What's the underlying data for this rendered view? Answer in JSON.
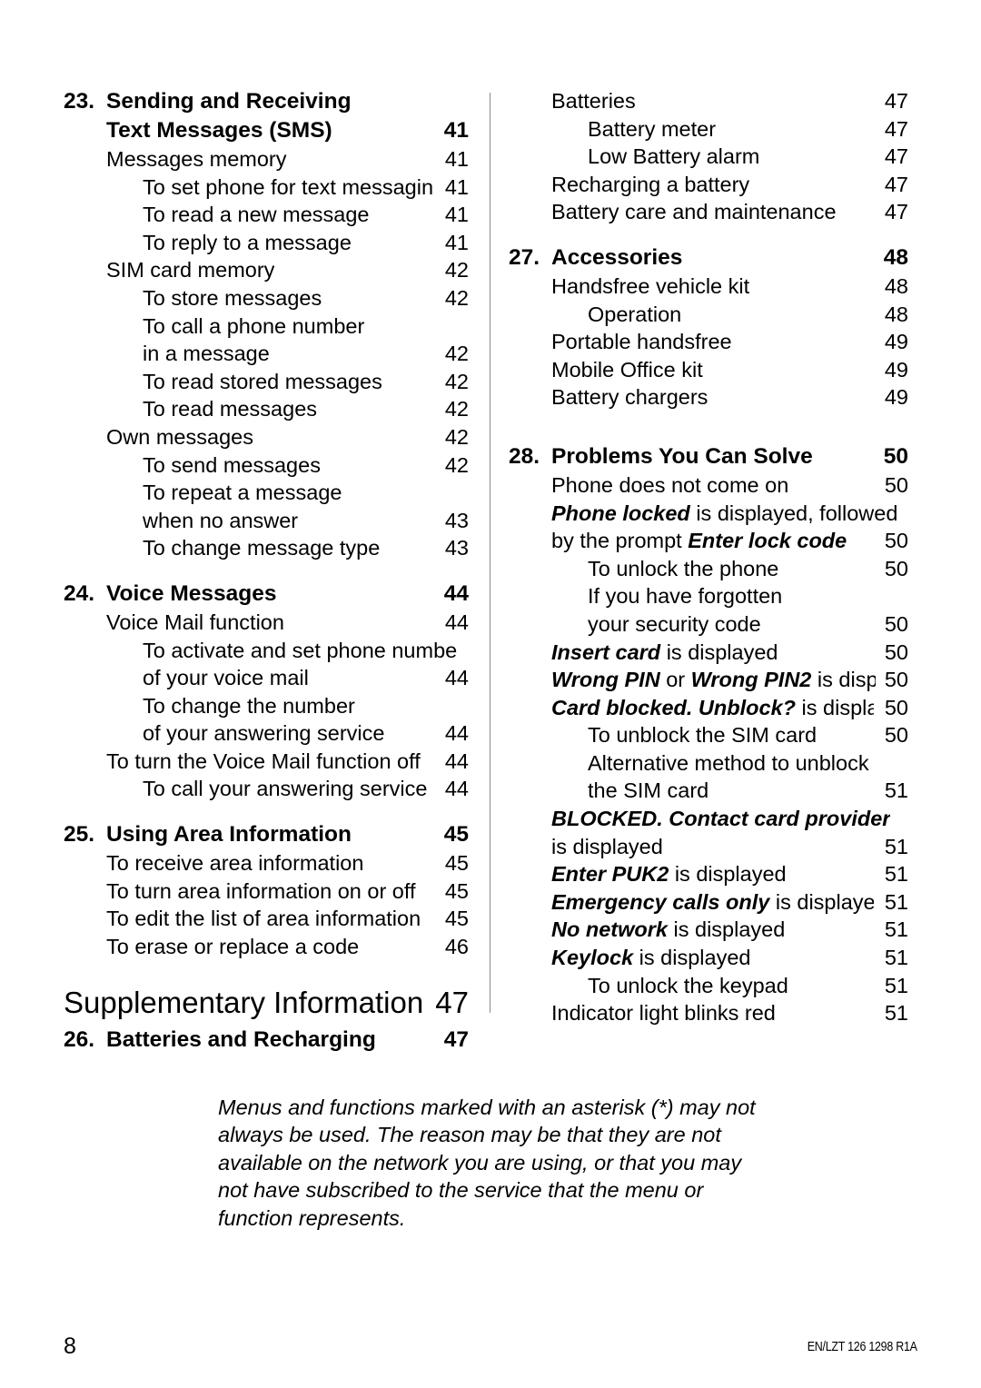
{
  "document": {
    "page_number": "8",
    "doc_code": "EN/LZT 126 1298 R1A"
  },
  "toc": {
    "left_column": [
      {
        "kind": "section",
        "name": "section-23",
        "number": "23.",
        "title": "Sending and Receiving",
        "title_line2": "Text Messages (SMS)",
        "page": "41"
      },
      {
        "kind": "entry",
        "level": 1,
        "text": "Messages memory",
        "page": "41"
      },
      {
        "kind": "entry",
        "level": 2,
        "text": "To set phone for text messaging",
        "page": "41"
      },
      {
        "kind": "entry",
        "level": 2,
        "text": "To read a new message",
        "page": "41"
      },
      {
        "kind": "entry",
        "level": 2,
        "text": "To reply to a message",
        "page": "41"
      },
      {
        "kind": "entry",
        "level": 1,
        "text": "SIM card memory",
        "page": "42"
      },
      {
        "kind": "entry",
        "level": 2,
        "text": "To store messages",
        "page": "42"
      },
      {
        "kind": "entry",
        "level": 2,
        "text": "To call a phone number",
        "page": ""
      },
      {
        "kind": "entry",
        "level": 2,
        "text": "in a message",
        "page": "42"
      },
      {
        "kind": "entry",
        "level": 2,
        "text": "To read stored messages",
        "page": "42"
      },
      {
        "kind": "entry",
        "level": 2,
        "text": "To read messages",
        "page": "42"
      },
      {
        "kind": "entry",
        "level": 1,
        "text": "Own messages",
        "page": "42"
      },
      {
        "kind": "entry",
        "level": 2,
        "text": "To send messages",
        "page": "42"
      },
      {
        "kind": "entry",
        "level": 2,
        "text": "To repeat a message",
        "page": ""
      },
      {
        "kind": "entry",
        "level": 2,
        "text": "when no answer",
        "page": "43"
      },
      {
        "kind": "entry",
        "level": 2,
        "text": "To change message type",
        "page": "43"
      },
      {
        "kind": "section",
        "name": "section-24",
        "number": "24.",
        "title": "Voice Messages",
        "page": "44"
      },
      {
        "kind": "entry",
        "level": 1,
        "text": "Voice Mail function",
        "page": "44"
      },
      {
        "kind": "entry",
        "level": 2,
        "text": "To activate and set phone number",
        "page": ""
      },
      {
        "kind": "entry",
        "level": 2,
        "text": "of your voice mail",
        "page": "44"
      },
      {
        "kind": "entry",
        "level": 2,
        "text": "To change the number",
        "page": ""
      },
      {
        "kind": "entry",
        "level": 2,
        "text": "of your answering service",
        "page": "44"
      },
      {
        "kind": "entry",
        "level": 1,
        "text": "To turn the Voice Mail function off",
        "page": "44"
      },
      {
        "kind": "entry",
        "level": 2,
        "text": "To call your answering service",
        "page": "44"
      },
      {
        "kind": "section",
        "name": "section-25",
        "number": "25.",
        "title": "Using Area Information",
        "page": "45"
      },
      {
        "kind": "entry",
        "level": 1,
        "text": "To receive area information",
        "page": "45"
      },
      {
        "kind": "entry",
        "level": 1,
        "text": "To turn area information on or off",
        "page": "45"
      },
      {
        "kind": "entry",
        "level": 1,
        "text": "To edit the list of area information",
        "page": "45"
      },
      {
        "kind": "entry",
        "level": 1,
        "text": "To erase or replace a code",
        "page": "46"
      },
      {
        "kind": "part",
        "name": "part-supplementary-information",
        "title": "Supplementary Information",
        "page": "47"
      },
      {
        "kind": "section",
        "name": "section-26",
        "number": "26.",
        "title": "Batteries and Recharging",
        "page": "47"
      }
    ],
    "right_column": [
      {
        "kind": "entry",
        "level": 1,
        "text": "Batteries",
        "page": "47"
      },
      {
        "kind": "entry",
        "level": 2,
        "text": "Battery meter",
        "page": "47"
      },
      {
        "kind": "entry",
        "level": 2,
        "text": "Low Battery alarm",
        "page": "47"
      },
      {
        "kind": "entry",
        "level": 1,
        "text": "Recharging a battery",
        "page": "47"
      },
      {
        "kind": "entry",
        "level": 1,
        "text": "Battery care and maintenance",
        "page": "47"
      },
      {
        "kind": "section",
        "name": "section-27",
        "number": "27.",
        "title": "Accessories",
        "page": "48"
      },
      {
        "kind": "entry",
        "level": 1,
        "text": "Handsfree vehicle kit",
        "page": "48"
      },
      {
        "kind": "entry",
        "level": 2,
        "text": "Operation",
        "page": "48"
      },
      {
        "kind": "entry",
        "level": 1,
        "text": "Portable handsfree",
        "page": "49"
      },
      {
        "kind": "entry",
        "level": 1,
        "text": "Mobile Office kit",
        "page": "49"
      },
      {
        "kind": "entry",
        "level": 1,
        "text": "Battery chargers",
        "page": "49"
      },
      {
        "kind": "section",
        "name": "section-28",
        "number": "28.",
        "title": "Problems You Can Solve",
        "page": "50"
      },
      {
        "kind": "entry",
        "level": 1,
        "text": "Phone does not come on",
        "page": "50"
      },
      {
        "kind": "entry_rich",
        "level": 1,
        "page": "",
        "parts": [
          {
            "style": "bolditalic",
            "text": "Phone locked"
          },
          {
            "style": "plain",
            "text": " is displayed, followed"
          }
        ]
      },
      {
        "kind": "entry_rich",
        "level": 1,
        "page": "50",
        "parts": [
          {
            "style": "plain",
            "text": "by the prompt "
          },
          {
            "style": "bolditalic",
            "text": "Enter lock code"
          }
        ]
      },
      {
        "kind": "entry",
        "level": 2,
        "text": "To unlock the phone",
        "page": "50"
      },
      {
        "kind": "entry",
        "level": 2,
        "text": "If you have forgotten",
        "page": ""
      },
      {
        "kind": "entry",
        "level": 2,
        "text": "your security code",
        "page": "50"
      },
      {
        "kind": "entry_rich",
        "level": 1,
        "page": "50",
        "parts": [
          {
            "style": "bolditalic",
            "text": "Insert card"
          },
          {
            "style": "plain",
            "text": " is displayed"
          }
        ]
      },
      {
        "kind": "entry_rich",
        "level": 1,
        "page": "50",
        "tight": true,
        "parts": [
          {
            "style": "bolditalic",
            "text": "Wrong PIN"
          },
          {
            "style": "plain",
            "text": " or "
          },
          {
            "style": "bolditalic",
            "text": "Wrong PIN2"
          },
          {
            "style": "plain",
            "text": " is displayed"
          }
        ]
      },
      {
        "kind": "entry_rich",
        "level": 1,
        "page": "50",
        "parts": [
          {
            "style": "bolditalic",
            "text": "Card blocked. Unblock?"
          },
          {
            "style": "plain",
            "text": " is displayed"
          }
        ]
      },
      {
        "kind": "entry",
        "level": 2,
        "text": "To unblock the SIM card",
        "page": "50"
      },
      {
        "kind": "entry",
        "level": 2,
        "text": "Alternative method to unblock",
        "page": ""
      },
      {
        "kind": "entry",
        "level": 2,
        "text": "the SIM card",
        "page": "51"
      },
      {
        "kind": "entry_rich",
        "level": 1,
        "page": "",
        "parts": [
          {
            "style": "bolditalic",
            "text": "BLOCKED. Contact card provider"
          }
        ]
      },
      {
        "kind": "entry",
        "level": 1,
        "text": "is displayed",
        "page": "51"
      },
      {
        "kind": "entry_rich",
        "level": 1,
        "page": "51",
        "parts": [
          {
            "style": "bolditalic",
            "text": "Enter PUK2"
          },
          {
            "style": "plain",
            "text": " is displayed"
          }
        ]
      },
      {
        "kind": "entry_rich",
        "level": 1,
        "page": "51",
        "parts": [
          {
            "style": "bolditalic",
            "text": "Emergency calls only"
          },
          {
            "style": "plain",
            "text": " is displayed"
          }
        ]
      },
      {
        "kind": "entry_rich",
        "level": 1,
        "page": "51",
        "parts": [
          {
            "style": "bolditalic",
            "text": "No network"
          },
          {
            "style": "plain",
            "text": " is displayed"
          }
        ]
      },
      {
        "kind": "entry_rich",
        "level": 1,
        "page": "51",
        "parts": [
          {
            "style": "bolditalic",
            "text": "Keylock"
          },
          {
            "style": "plain",
            "text": " is displayed"
          }
        ]
      },
      {
        "kind": "entry",
        "level": 2,
        "text": "To unlock the keypad",
        "page": "51"
      },
      {
        "kind": "entry",
        "level": 1,
        "text": "Indicator light blinks red",
        "page": "51"
      }
    ]
  },
  "footnote": {
    "text": "Menus and functions marked with an asterisk (*) may not always be used. The reason may be that they are not available on the network you are using, or that you may not have subscribed to the service that the menu or function represents."
  }
}
